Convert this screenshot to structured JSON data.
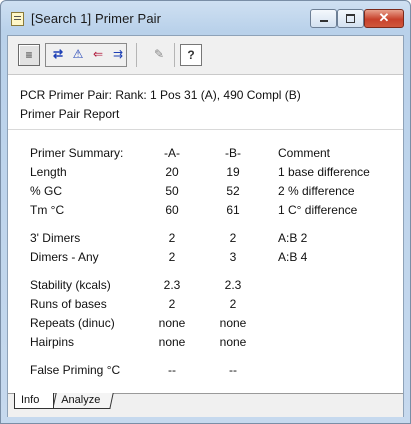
{
  "window": {
    "title": "[Search 1] Primer Pair",
    "min_label": "",
    "max_label": "",
    "close_label": "✕"
  },
  "toolbar": {
    "icons": [
      "report-icon",
      "swap-icon",
      "warning-icon",
      "arrow-left-icon",
      "equals-icon",
      "primer-icon",
      "help-icon"
    ],
    "glyphs": [
      "≡",
      "⇄",
      "⚠",
      "⇐",
      "⇉",
      "✎",
      "?"
    ]
  },
  "header": {
    "line1": "PCR Primer Pair:    Rank: 1   Pos 31 (A),  490 Compl (B)",
    "line2": "Primer Pair Report"
  },
  "summary": {
    "heading": "Primer Summary:",
    "col_a": "-A-",
    "col_b": "-B-",
    "col_comment": "Comment",
    "rows": [
      {
        "label": "Length",
        "a": "20",
        "b": "19",
        "comment": "1 base difference"
      },
      {
        "label": "% GC",
        "a": "50",
        "b": "52",
        "comment": "2 % difference"
      },
      {
        "label": "Tm °C",
        "a": "60",
        "b": "61",
        "comment": "1 C° difference"
      }
    ]
  },
  "dimers": {
    "rows": [
      {
        "label": "3' Dimers",
        "a": "2",
        "b": "2",
        "comment": "A:B   2"
      },
      {
        "label": "Dimers - Any",
        "a": "2",
        "b": "3",
        "comment": "A:B   4"
      }
    ]
  },
  "stability": {
    "rows": [
      {
        "label": "Stability (kcals)",
        "a": "2.3",
        "b": "2.3"
      },
      {
        "label": "Runs of bases",
        "a": "2",
        "b": "2"
      },
      {
        "label": "Repeats (dinuc)",
        "a": "none",
        "b": "none"
      },
      {
        "label": "Hairpins",
        "a": "none",
        "b": "none"
      }
    ]
  },
  "false_priming": {
    "label": "False Priming  °C",
    "a": "--",
    "b": "--"
  },
  "tabs": {
    "info": "Info",
    "analyze": "Analyze"
  }
}
